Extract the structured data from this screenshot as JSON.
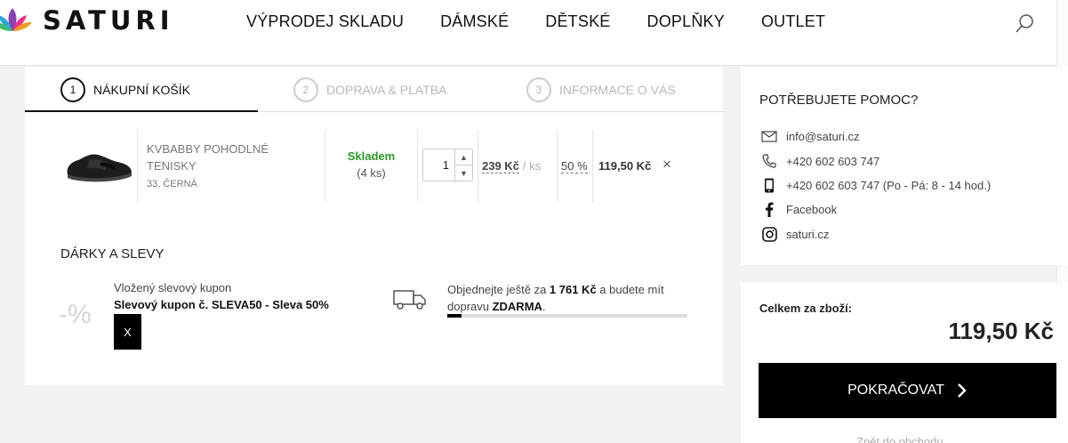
{
  "header": {
    "brand": "SATURI",
    "nav": [
      "VÝPRODEJ SKLADU",
      "DÁMSKÉ",
      "DĚTSKÉ",
      "DOPLŇKY",
      "OUTLET"
    ],
    "icons": [
      "search-icon",
      "user-icon"
    ]
  },
  "steps": [
    {
      "num": "1",
      "label": "NÁKUPNÍ KOŠÍK",
      "active": true
    },
    {
      "num": "2",
      "label": "DOPRAVA & PLATBA",
      "active": false
    },
    {
      "num": "3",
      "label": "INFORMACE O VÁS",
      "active": false
    }
  ],
  "cart_item": {
    "name": "KVBABBY POHODLNÉ TENISKY",
    "variant": "33, ČERNÁ",
    "stock_status": "Skladem",
    "stock_count": "(4 ks)",
    "quantity": "1",
    "unit_price": "239 Kč",
    "per_unit": "/ ks",
    "discount": "50 %",
    "total": "119,50 Kč",
    "remove": "×"
  },
  "gifts": {
    "title": "DÁRKY A SLEVY",
    "percent_symbol": "-%",
    "coupon_label": "Vložený slevový kupon",
    "coupon_name": "Slevový kupon č. SLEVA50 - Sleva 50%",
    "coupon_remove": "X",
    "shipping_pre": "Objednejte ještě za ",
    "shipping_amount": "1 761 Kč",
    "shipping_mid": " a budete mít dopravu ",
    "shipping_free": "ZDARMA",
    "shipping_post": ".",
    "shipping_progress": 0.06
  },
  "help": {
    "title": "POTŘEBUJETE POMOC?",
    "items": [
      {
        "icon": "mail-icon",
        "text": "info@saturi.cz"
      },
      {
        "icon": "phone-icon",
        "text": "+420 602 603 747"
      },
      {
        "icon": "mobile-icon",
        "text": "+420 602 603 747 (Po - Pá: 8 - 14 hod.)"
      },
      {
        "icon": "facebook-icon",
        "text": "Facebook"
      },
      {
        "icon": "instagram-icon",
        "text": "saturi.cz"
      }
    ]
  },
  "summary": {
    "label": "Celkem za zboží:",
    "value": "119,50 Kč",
    "continue_label": "POKRAČOVAT",
    "back_link": "Zpět do obchodu"
  },
  "colors": {
    "stock_green": "#2a9a2a",
    "primary_black": "#000000",
    "background": "#f2f2f2"
  }
}
